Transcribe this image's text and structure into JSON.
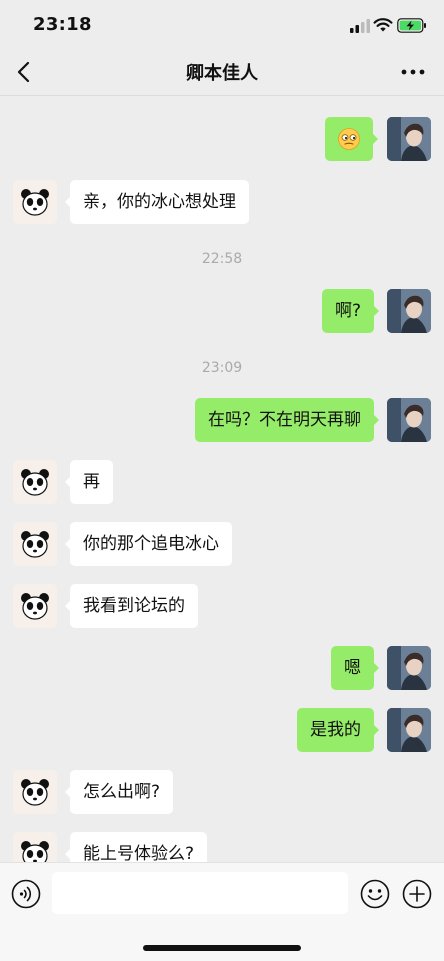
{
  "status_bar": {
    "time": "23:18"
  },
  "header": {
    "title": "卿本佳人"
  },
  "messages": [
    {
      "side": "right",
      "type": "emoji",
      "text": ""
    },
    {
      "side": "left",
      "text": "亲，你的冰心想处理"
    },
    {
      "type": "time",
      "text": "22:58"
    },
    {
      "side": "right",
      "text": "啊?"
    },
    {
      "type": "time",
      "text": "23:09"
    },
    {
      "side": "right",
      "text": "在吗？不在明天再聊"
    },
    {
      "side": "left",
      "text": "再"
    },
    {
      "side": "left",
      "text": "你的那个追电冰心"
    },
    {
      "side": "left",
      "text": "我看到论坛的"
    },
    {
      "side": "right",
      "text": "嗯"
    },
    {
      "side": "right",
      "text": "是我的"
    },
    {
      "side": "left",
      "text": "怎么出啊?"
    },
    {
      "side": "left",
      "text": "能上号体验么?"
    }
  ],
  "input": {
    "value": "",
    "placeholder": ""
  },
  "colors": {
    "background": "#ededed",
    "bubble_self": "#95ec69",
    "bubble_other": "#ffffff",
    "battery_charging": "#4cd964"
  },
  "icons": [
    "back-icon",
    "more-icon",
    "voice-icon",
    "emoji-icon",
    "plus-icon",
    "panda-avatar-icon",
    "user-photo-avatar"
  ]
}
